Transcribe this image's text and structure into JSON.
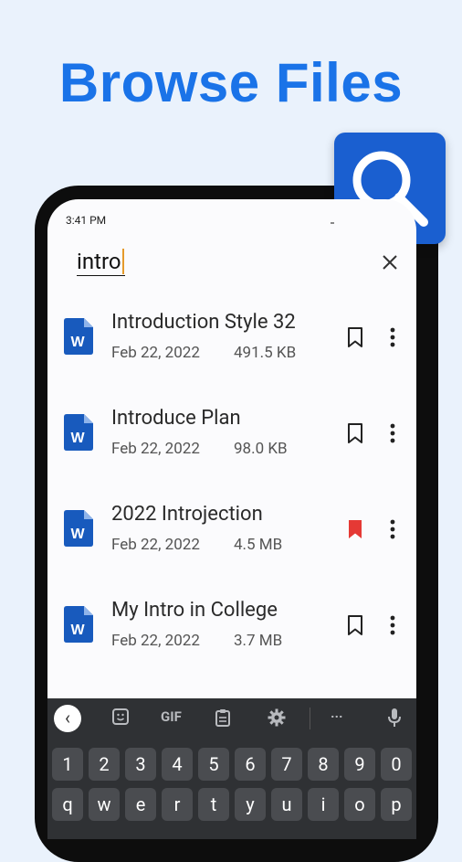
{
  "headline": "Browse Files",
  "status": {
    "time": "3:41 PM"
  },
  "search": {
    "query": "intro"
  },
  "files": [
    {
      "name": "Introduction Style 32",
      "date": "Feb 22, 2022",
      "size": "491.5 KB",
      "bookmarked": false
    },
    {
      "name": "Introduce Plan",
      "date": "Feb 22, 2022",
      "size": "98.0 KB",
      "bookmarked": false
    },
    {
      "name": "2022 Introjection",
      "date": "Feb 22, 2022",
      "size": "4.5 MB",
      "bookmarked": true
    },
    {
      "name": "My Intro in College",
      "date": "Feb 22, 2022",
      "size": "3.7 MB",
      "bookmarked": false
    }
  ],
  "keyboard": {
    "toolbar": {
      "gif": "GIF",
      "back": "‹",
      "more": "···"
    },
    "number_row": [
      "1",
      "2",
      "3",
      "4",
      "5",
      "6",
      "7",
      "8",
      "9",
      "0"
    ],
    "letter_row": [
      "q",
      "w",
      "e",
      "r",
      "t",
      "y",
      "u",
      "i",
      "o",
      "p"
    ]
  },
  "colors": {
    "accent": "#1a73e8",
    "word_blue": "#185abd",
    "bookmark_active": "#e53935"
  }
}
